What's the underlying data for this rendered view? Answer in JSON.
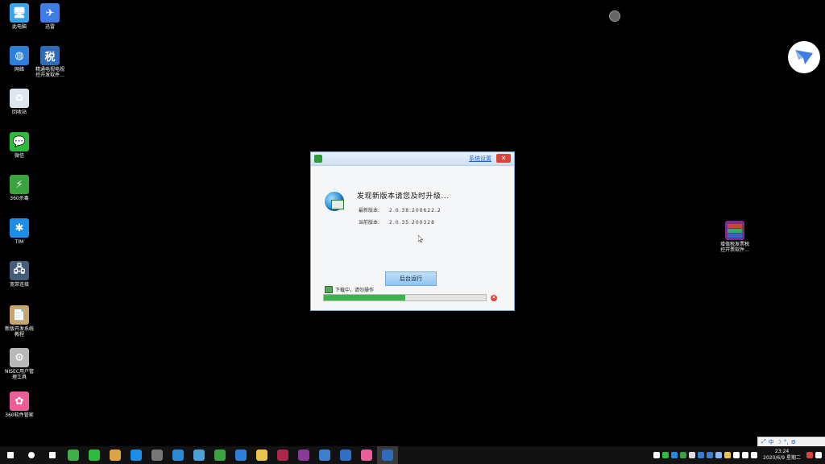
{
  "desktop_icons": [
    {
      "label": "此电脑",
      "color": "#3ba4e8",
      "glyph": "🖥"
    },
    {
      "label": "迅雷",
      "color": "#3e7ce6",
      "glyph": "✈"
    },
    {
      "label": "网络",
      "color": "#2f7fd8",
      "glyph": "◍"
    },
    {
      "label": "精通电视电视\n控开发软件...",
      "color": "#2e6bb8",
      "glyph": "税"
    },
    {
      "label": "回收站",
      "color": "#dde6ee",
      "glyph": "♻"
    },
    {
      "label": "微信",
      "color": "#2dbb3b",
      "glyph": "💬"
    },
    {
      "label": "360杀毒",
      "color": "#3aa23f",
      "glyph": "⚡"
    },
    {
      "label": "TIM",
      "color": "#1e8de8",
      "glyph": "✱"
    },
    {
      "label": "宽带连接",
      "color": "#455d7a",
      "glyph": "🖧"
    },
    {
      "label": "新版开发系统\n教程",
      "color": "#c9a46a",
      "glyph": "📄"
    },
    {
      "label": "NISEC用户管\n理工具",
      "color": "#b9b9b9",
      "glyph": "⚙"
    },
    {
      "label": "360软件管家",
      "color": "#e95f9a",
      "glyph": "✿"
    }
  ],
  "right_icons": {
    "winrar_label": "增值税发票税\n控开票软件..."
  },
  "dialog": {
    "sys_link": "系统设置",
    "close_label": "✕",
    "headline": "发现新版本请您及时升级...",
    "latest_label": "最新版本:",
    "latest_value": "2.0.38.200622.2",
    "current_label": "当前版本:",
    "current_value": "2.0.35.200328",
    "bg_button": "后台运行",
    "download_status": "下载中，请勿操作",
    "progress_percent": 0.5,
    "cancel_label": "✕"
  },
  "taskbar": {
    "items": [
      {
        "name": "start-icon",
        "color": "#ffffff"
      },
      {
        "name": "search-icon",
        "color": "#ffffff"
      },
      {
        "name": "task-view-icon",
        "color": "#ffffff"
      },
      {
        "name": "app-green-icon",
        "color": "#3fae49"
      },
      {
        "name": "wechat-icon",
        "color": "#2dbb3b"
      },
      {
        "name": "app-folder-icon",
        "color": "#d9a441"
      },
      {
        "name": "tim-icon",
        "color": "#1e8de8"
      },
      {
        "name": "app-gray-icon",
        "color": "#777777"
      },
      {
        "name": "app-k-icon",
        "color": "#2b8ad8"
      },
      {
        "name": "app-paint-icon",
        "color": "#4aa3d8"
      },
      {
        "name": "app-360-icon",
        "color": "#3aa23f"
      },
      {
        "name": "app-people-icon",
        "color": "#2f7fd8"
      },
      {
        "name": "file-explorer-icon",
        "color": "#e8c44a"
      },
      {
        "name": "media-player-icon",
        "color": "#b0264a"
      },
      {
        "name": "winrar-icon",
        "color": "#8b3a9a"
      },
      {
        "name": "app-blue-icon",
        "color": "#3a7fd0"
      },
      {
        "name": "app-blue2-icon",
        "color": "#2f6fc4"
      },
      {
        "name": "360-manager-icon",
        "color": "#e95f9a"
      },
      {
        "name": "tax-app-icon",
        "color": "#2e6bb8"
      }
    ],
    "time": "23:24",
    "date": "2020/6/9 星期二",
    "ime_text": "中"
  }
}
